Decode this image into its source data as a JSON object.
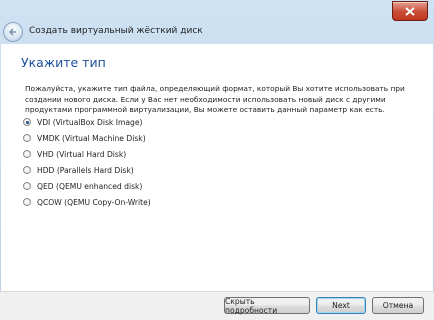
{
  "wizard": {
    "title": "Создать виртуальный жёсткий диск",
    "page_title": "Укажите тип",
    "description": "Пожалуйста, укажите тип файла, определяющий формат, который Вы хотите использовать при создании нового диска. Если у Вас нет необходимости использовать новый диск с другими продуктами программной виртуализации, Вы можете оставить данный параметр как есть."
  },
  "options": [
    {
      "label": "VDI (VirtualBox Disk Image)",
      "checked": true
    },
    {
      "label": "VMDK (Virtual Machine Disk)",
      "checked": false
    },
    {
      "label": "VHD (Virtual Hard Disk)",
      "checked": false
    },
    {
      "label": "HDD (Parallels Hard Disk)",
      "checked": false
    },
    {
      "label": "QED (QEMU enhanced disk)",
      "checked": false
    },
    {
      "label": "QCOW (QEMU Copy-On-Write)",
      "checked": false
    }
  ],
  "buttons": {
    "details": "Скрыть подробности",
    "next": "Next",
    "cancel": "Отмена"
  },
  "icons": {
    "close": "close-icon",
    "back": "back-arrow-icon"
  }
}
